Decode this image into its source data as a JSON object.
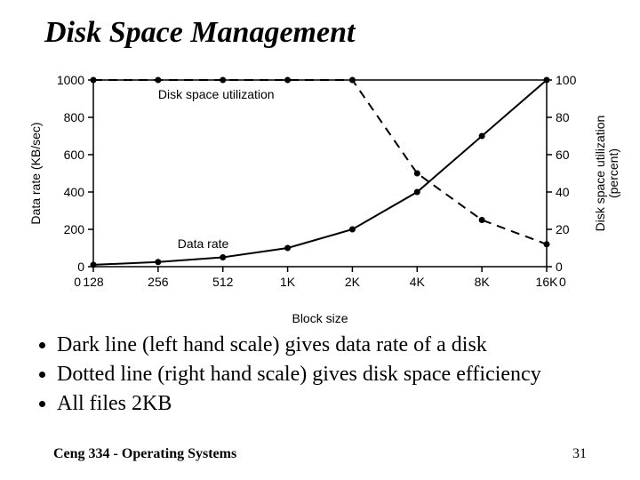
{
  "title": "Disk Space Management",
  "x_caption": "Block size",
  "bullets": [
    "Dark line (left hand scale) gives data rate of a disk",
    "Dotted line (right hand scale) gives disk space efficiency",
    "All files 2KB"
  ],
  "footer_left": "Ceng 334 - Operating Systems",
  "footer_right": "31",
  "chart_data": {
    "type": "line",
    "categories": [
      "128",
      "256",
      "512",
      "1K",
      "2K",
      "4K",
      "8K",
      "16K"
    ],
    "series": [
      {
        "name": "Data rate",
        "axis": "left",
        "style": "solid",
        "values": [
          10,
          25,
          50,
          100,
          200,
          400,
          700,
          1000
        ]
      },
      {
        "name": "Disk space utilization",
        "axis": "right",
        "style": "dashed",
        "values": [
          100,
          100,
          100,
          100,
          100,
          50,
          25,
          12
        ]
      }
    ],
    "left_axis": {
      "label": "Data rate (KB/sec)",
      "min": 0,
      "max": 1000,
      "ticks": [
        0,
        200,
        400,
        600,
        800,
        1000
      ]
    },
    "right_axis": {
      "label": "Disk space utilization\n(percent)",
      "min": 0,
      "max": 100,
      "ticks": [
        0,
        20,
        40,
        60,
        80,
        100
      ]
    },
    "x_terminal_label": "0",
    "series_label_positions": {
      "Disk space utilization": {
        "x_index": 1,
        "y_value": 90,
        "axis": "right"
      },
      "Data rate": {
        "x_index": 1.3,
        "y_value": 100,
        "axis": "left"
      }
    }
  }
}
